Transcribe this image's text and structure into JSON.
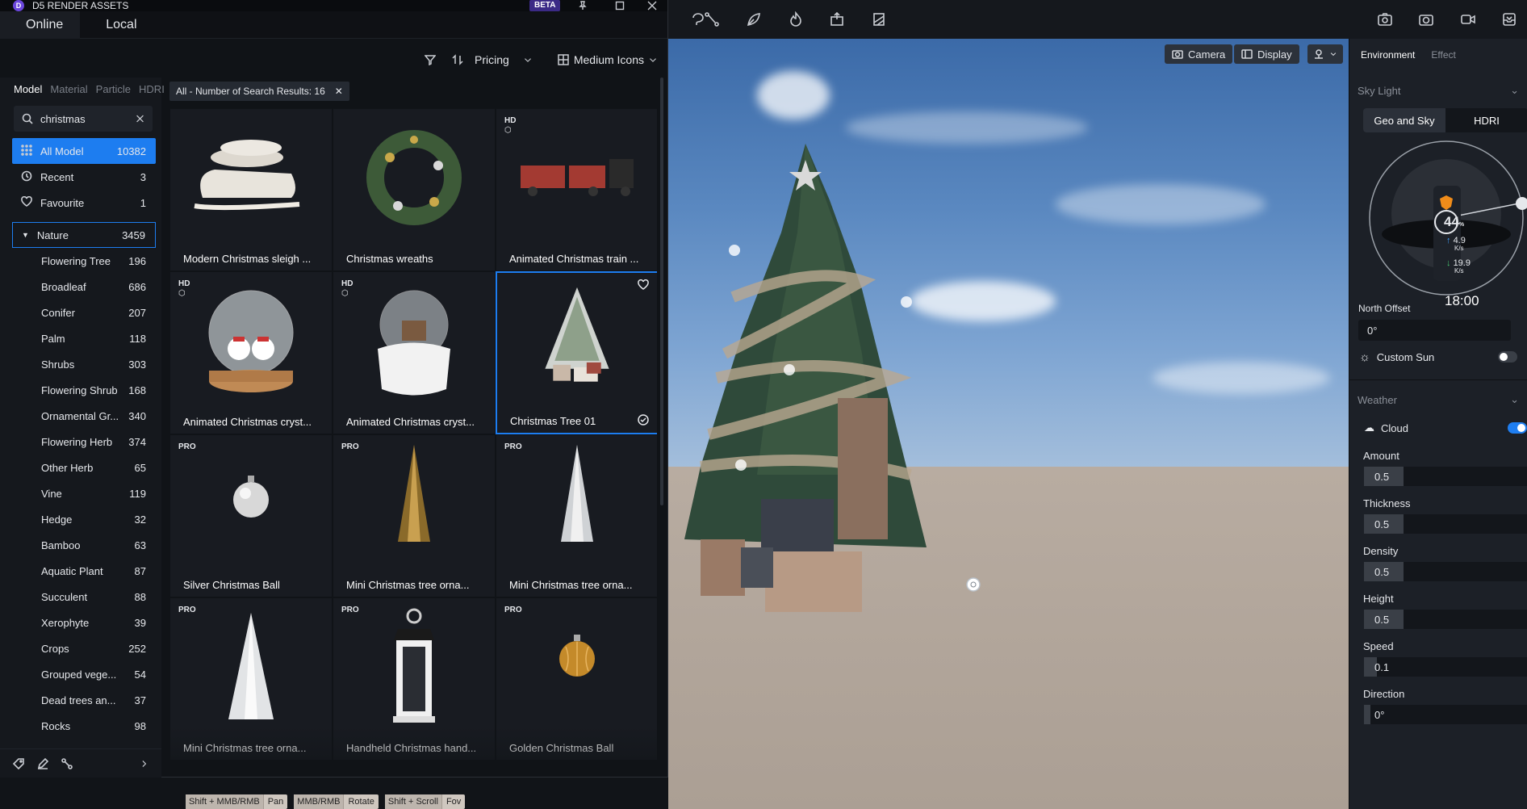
{
  "asset_window": {
    "title": "D5 RENDER ASSETS",
    "beta": "BETA",
    "tabs": [
      "Online",
      "Local"
    ],
    "toolbar": {
      "pricing": "Pricing",
      "view": "Medium Icons"
    },
    "category_tabs": [
      "Model",
      "Material",
      "Particle",
      "HDRI"
    ],
    "search_value": "christmas",
    "filter_chip": "All - Number of Search Results: 16",
    "main_categories": [
      {
        "label": "All Model",
        "count": "10382",
        "icon": "grid-icon"
      },
      {
        "label": "Recent",
        "count": "3",
        "icon": "history-icon"
      },
      {
        "label": "Favourite",
        "count": "1",
        "icon": "heart-icon"
      }
    ],
    "nature": {
      "label": "Nature",
      "count": "3459"
    },
    "subcategories": [
      {
        "label": "Flowering Tree",
        "count": "196"
      },
      {
        "label": "Broadleaf",
        "count": "686"
      },
      {
        "label": "Conifer",
        "count": "207"
      },
      {
        "label": "Palm",
        "count": "118"
      },
      {
        "label": "Shrubs",
        "count": "303"
      },
      {
        "label": "Flowering Shrub",
        "count": "168"
      },
      {
        "label": "Ornamental Gr...",
        "count": "340"
      },
      {
        "label": "Flowering Herb",
        "count": "374"
      },
      {
        "label": "Other Herb",
        "count": "65"
      },
      {
        "label": "Vine",
        "count": "119"
      },
      {
        "label": "Hedge",
        "count": "32"
      },
      {
        "label": "Bamboo",
        "count": "63"
      },
      {
        "label": "Aquatic Plant",
        "count": "87"
      },
      {
        "label": "Succulent",
        "count": "88"
      },
      {
        "label": "Xerophyte",
        "count": "39"
      },
      {
        "label": "Crops",
        "count": "252"
      },
      {
        "label": "Grouped vege...",
        "count": "54"
      },
      {
        "label": "Dead trees an...",
        "count": "37"
      },
      {
        "label": "Rocks",
        "count": "98"
      }
    ],
    "results": [
      {
        "name": "Modern Christmas sleigh ...",
        "badge": "",
        "thumb": "sleigh"
      },
      {
        "name": "Christmas wreaths",
        "badge": "",
        "thumb": "wreath"
      },
      {
        "name": "Animated Christmas train ...",
        "badge": "HD",
        "thumb": "train"
      },
      {
        "name": "Animated Christmas cryst...",
        "badge": "HD",
        "thumb": "globe1"
      },
      {
        "name": "Animated Christmas cryst...",
        "badge": "HD",
        "thumb": "globe2"
      },
      {
        "name": "Christmas Tree 01",
        "badge": "",
        "thumb": "tree",
        "selected": true
      },
      {
        "name": "Silver Christmas Ball",
        "badge": "PRO",
        "thumb": "ball-silver"
      },
      {
        "name": "Mini Christmas tree orna...",
        "badge": "PRO",
        "thumb": "cone-gold"
      },
      {
        "name": "Mini Christmas tree orna...",
        "badge": "PRO",
        "thumb": "cone-silver"
      },
      {
        "name": "Mini Christmas tree orna...",
        "badge": "PRO",
        "thumb": "cone-white"
      },
      {
        "name": "Handheld Christmas hand...",
        "badge": "PRO",
        "thumb": "lantern"
      },
      {
        "name": "Golden Christmas Ball",
        "badge": "PRO",
        "thumb": "ball-gold"
      }
    ]
  },
  "viewport": {
    "camera": "Camera",
    "display": "Display",
    "hints": [
      {
        "keys": "Shift + MMB/RMB",
        "action": "Pan"
      },
      {
        "keys": "MMB/RMB",
        "action": "Rotate"
      },
      {
        "keys": "Shift + Scroll",
        "action": "Fov"
      }
    ]
  },
  "right_panel": {
    "tabs": [
      "Environment",
      "Effect"
    ],
    "sky_light": "Sky Light",
    "sky_modes": [
      "Geo and Sky",
      "HDRI"
    ],
    "sun_percent": "44",
    "sun_percent_unit": "%",
    "up_rate": "4.9",
    "down_rate": "19.9",
    "rate_unit": "K/s",
    "time": "18:00",
    "north_offset_label": "North Offset",
    "north_offset_value": "0°",
    "custom_sun": "Custom Sun",
    "weather": "Weather",
    "cloud": "Cloud",
    "params": [
      {
        "label": "Amount",
        "value": "0.5",
        "level": 0.5
      },
      {
        "label": "Thickness",
        "value": "0.5",
        "level": 0.5
      },
      {
        "label": "Density",
        "value": "0.5",
        "level": 0.5
      },
      {
        "label": "Height",
        "value": "0.5",
        "level": 0.5
      },
      {
        "label": "Speed",
        "value": "0.1",
        "level": 0.1
      },
      {
        "label": "Direction",
        "value": "0°",
        "level": 0
      }
    ]
  }
}
